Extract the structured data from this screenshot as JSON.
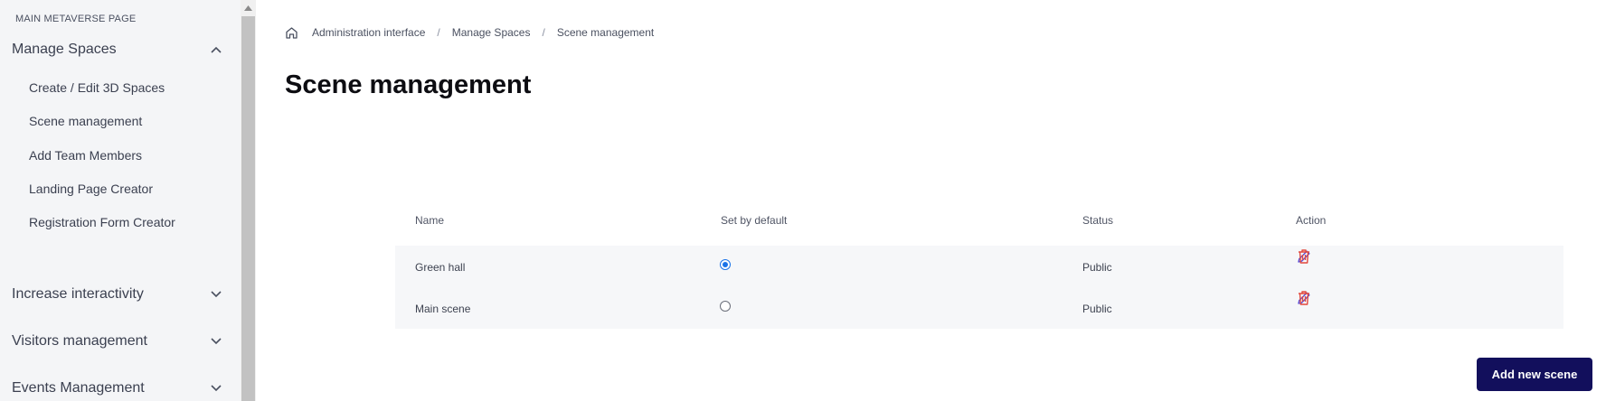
{
  "sidebar": {
    "heading": "MAIN METAVERSE PAGE",
    "sections": [
      {
        "label": "Manage Spaces",
        "expanded": true,
        "icon": "chevron-up-icon"
      },
      {
        "label": "Increase interactivity",
        "expanded": false,
        "icon": "chevron-down-icon"
      },
      {
        "label": "Visitors management",
        "expanded": false,
        "icon": "chevron-down-icon"
      },
      {
        "label": "Events Management",
        "expanded": false,
        "icon": "chevron-down-icon"
      }
    ],
    "sub_items": [
      {
        "label": "Create / Edit 3D Spaces"
      },
      {
        "label": "Scene management"
      },
      {
        "label": "Add Team Members"
      },
      {
        "label": "Landing Page Creator"
      },
      {
        "label": "Registration Form Creator"
      }
    ]
  },
  "breadcrumb": {
    "icon": "home-icon",
    "items": [
      "Administration interface",
      "Manage Spaces",
      "Scene management"
    ],
    "separator": "/"
  },
  "page_title": "Scene management",
  "table": {
    "headers": {
      "name": "Name",
      "default": "Set by default",
      "status": "Status",
      "action": "Action"
    },
    "rows": [
      {
        "name": "Green hall",
        "default": true,
        "status": "Public"
      },
      {
        "name": "Main scene",
        "default": false,
        "status": "Public"
      }
    ]
  },
  "add_button": "Add new scene",
  "colors": {
    "accent": "#120f5c",
    "edit_icon": "#5b4fd6",
    "delete_icon": "#e2483d",
    "radio": "#1a73e8"
  }
}
